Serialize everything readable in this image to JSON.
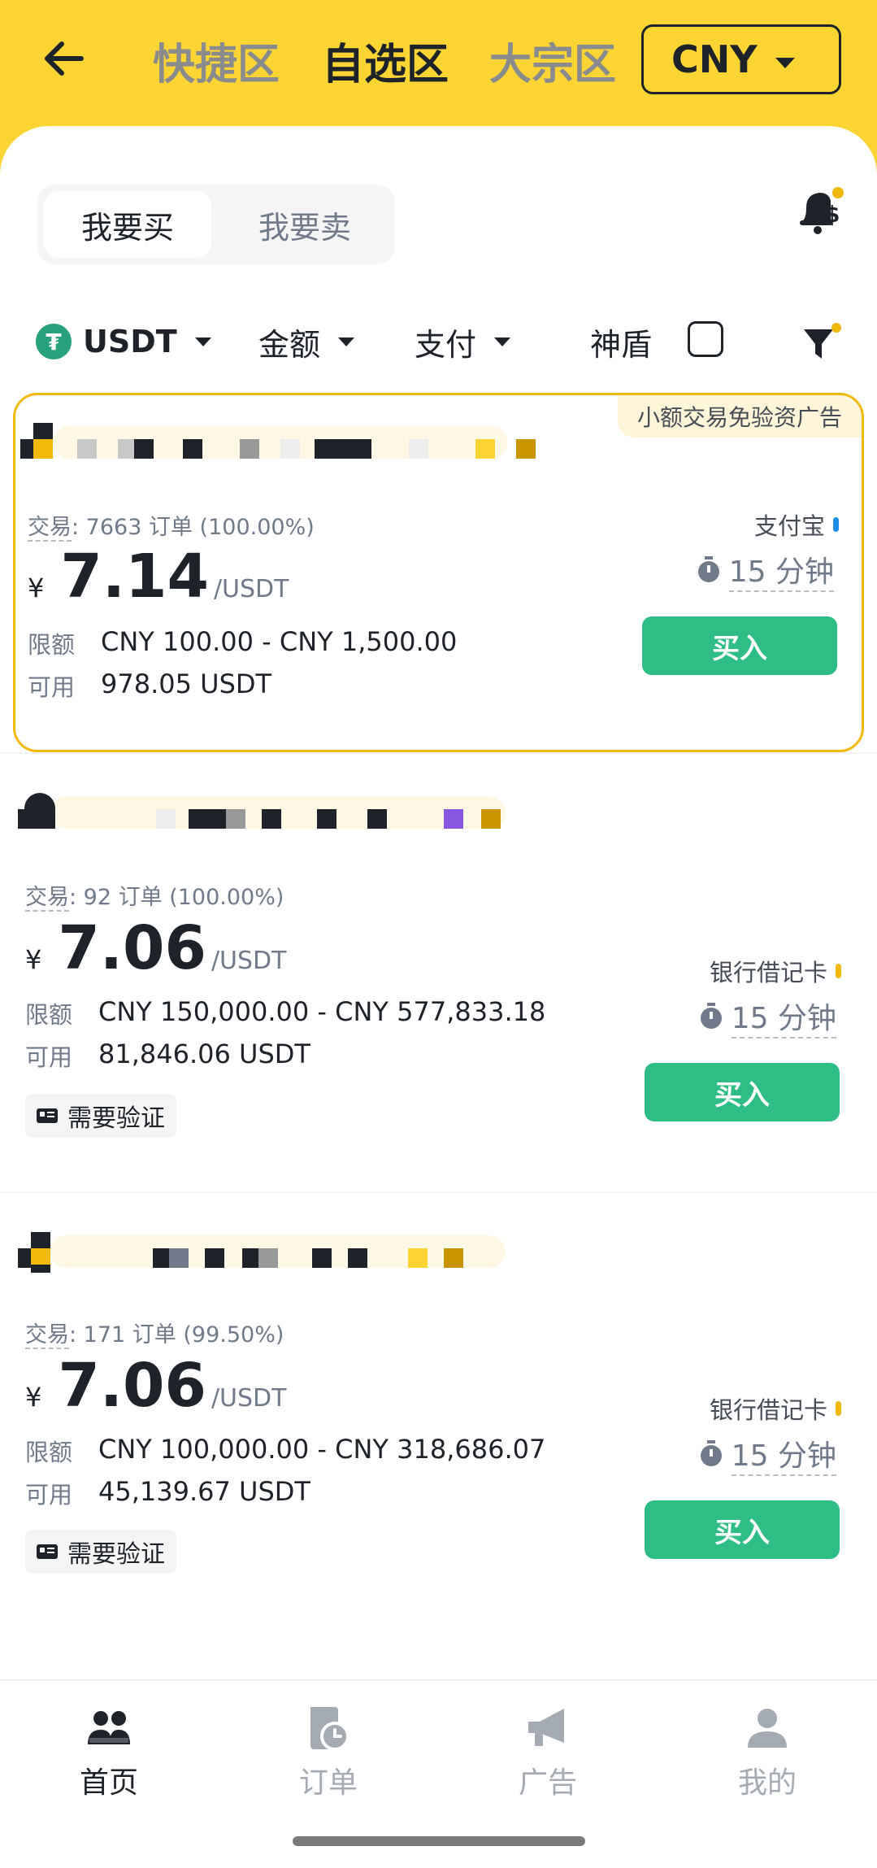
{
  "header": {
    "tabs": [
      "快捷区",
      "自选区",
      "大宗区"
    ],
    "active_tab_index": 1,
    "currency": "CNY"
  },
  "side_toggle": {
    "buy_label": "我要买",
    "sell_label": "我要卖",
    "selected": "buy"
  },
  "filters": {
    "asset": "USDT",
    "amount_label": "金额",
    "payment_label": "支付",
    "shield_label": "神盾"
  },
  "ads": [
    {
      "tag": "小额交易免验资广告",
      "trade_label": "交易",
      "trade_info": ": 7663 订单 (100.00%)",
      "currency_symbol": "¥",
      "price": "7.14",
      "unit": "/USDT",
      "limit_label": "限额",
      "limit_value": "CNY 100.00 - CNY 1,500.00",
      "available_label": "可用",
      "available_value": "978.05 USDT",
      "payment_method": "支付宝",
      "payment_color": "#1E8FE8",
      "time": "15 分钟",
      "buy_label": "买入"
    },
    {
      "trade_label": "交易",
      "trade_info": ": 92 订单 (100.00%)",
      "currency_symbol": "¥",
      "price": "7.06",
      "unit": "/USDT",
      "limit_label": "限额",
      "limit_value": "CNY 150,000.00 - CNY 577,833.18",
      "available_label": "可用",
      "available_value": "81,846.06 USDT",
      "payment_method": "银行借记卡",
      "payment_color": "#F0B90B",
      "time": "15 分钟",
      "verify_label": "需要验证",
      "buy_label": "买入"
    },
    {
      "trade_label": "交易",
      "trade_info": ": 171 订单 (99.50%)",
      "currency_symbol": "¥",
      "price": "7.06",
      "unit": "/USDT",
      "limit_label": "限额",
      "limit_value": "CNY 100,000.00 - CNY 318,686.07",
      "available_label": "可用",
      "available_value": "45,139.67 USDT",
      "payment_method": "银行借记卡",
      "payment_color": "#F0B90B",
      "time": "15 分钟",
      "verify_label": "需要验证",
      "buy_label": "买入"
    }
  ],
  "bottom_nav": [
    {
      "label": "首页",
      "icon": "people-icon",
      "active": true
    },
    {
      "label": "订单",
      "icon": "order-icon",
      "active": false
    },
    {
      "label": "广告",
      "icon": "megaphone-icon",
      "active": false
    },
    {
      "label": "我的",
      "icon": "user-icon",
      "active": false
    }
  ],
  "colors": {
    "brand_yellow": "#FCD535",
    "buy_green": "#2EBD85",
    "highlight_border": "#F0B90B"
  }
}
